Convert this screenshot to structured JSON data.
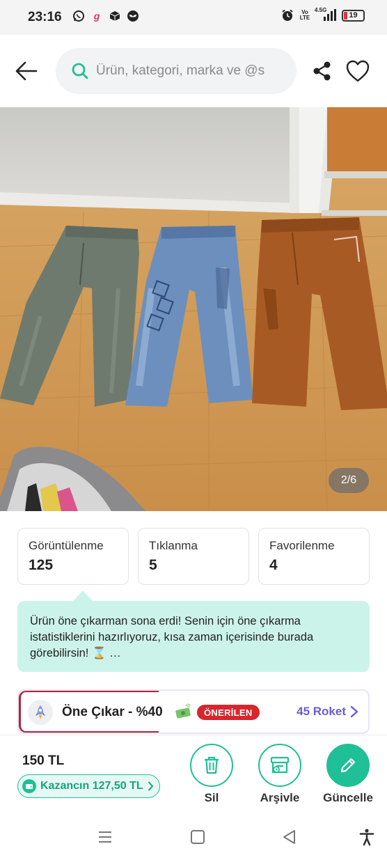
{
  "status_bar": {
    "time": "23:16",
    "network": "4.5G",
    "volte": "Vo LTE",
    "battery": "19",
    "battery_color": "#e0353b"
  },
  "header": {
    "search_placeholder": "Ürün, kategori, marka ve @s",
    "icons": [
      "back-arrow-icon",
      "search-icon",
      "share-icon",
      "heart-icon"
    ]
  },
  "photo": {
    "counter": "2/6",
    "subject": "three pairs of children's jeans"
  },
  "stats": [
    {
      "label": "Görüntülenme",
      "value": "125"
    },
    {
      "label": "Tıklanma",
      "value": "5"
    },
    {
      "label": "Favorilenme",
      "value": "4"
    }
  ],
  "info": {
    "text": "Ürün öne çıkarman sona erdi! Senin için öne çıkarma istatistiklerini hazırlıyoruz, kısa zaman içerisinde burada görebilirsin! ⌛ …",
    "bg_color": "#ccf3ea"
  },
  "promote": {
    "title": "Öne Çıkar - %40",
    "badge": "ÖNERİLEN",
    "roket": "45 Roket",
    "progress": 0.4
  },
  "bottom": {
    "price": "150 TL",
    "earn": "Kazancın 127,50 TL",
    "actions": [
      {
        "label": "Sil",
        "icon": "trash-icon"
      },
      {
        "label": "Arşivle",
        "icon": "archive-icon"
      },
      {
        "label": "Güncelle",
        "icon": "pencil-icon"
      }
    ],
    "accent": "#1fbf97"
  }
}
